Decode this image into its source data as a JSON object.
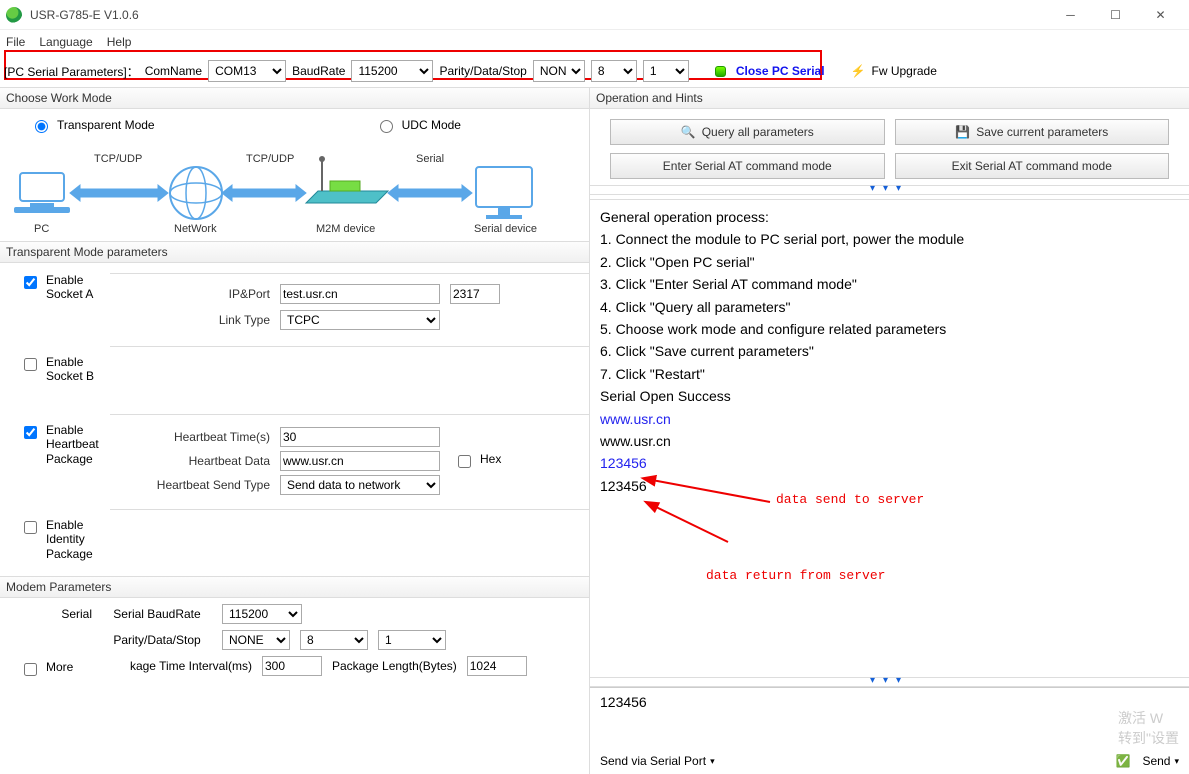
{
  "titlebar": {
    "title": "USR-G785-E V1.0.6"
  },
  "menu": {
    "file": "File",
    "language": "Language",
    "help": "Help"
  },
  "toolbar": {
    "pcparams_label": "[PC Serial Parameters]：",
    "comname_label": "ComName",
    "comname": "COM13",
    "baud_label": "BaudRate",
    "baud": "115200",
    "pds_label": "Parity/Data/Stop",
    "parity": "NONE",
    "databits": "8",
    "stopbits": "1",
    "close_serial": "Close PC Serial",
    "fw": "Fw Upgrade"
  },
  "workmode": {
    "header": "Choose Work Mode",
    "transparent": "Transparent Mode",
    "udc": "UDC Mode",
    "diagram": {
      "pc": "PC",
      "network": "NetWork",
      "m2m": "M2M device",
      "serial_dev": "Serial device",
      "tcpudp": "TCP/UDP",
      "serial": "Serial"
    }
  },
  "tparams": {
    "header": "Transparent Mode parameters",
    "enable_a": "Enable Socket A",
    "ipport_label": "IP&Port",
    "ip": "test.usr.cn",
    "port": "2317",
    "linktype_label": "Link Type",
    "linktype": "TCPC",
    "enable_b": "Enable Socket B",
    "enable_hb": "Enable Heartbeat Package",
    "hb_time_label": "Heartbeat Time(s)",
    "hb_time": "30",
    "hb_data_label": "Heartbeat Data",
    "hb_data": "www.usr.cn",
    "hex": "Hex",
    "hb_sendtype_label": "Heartbeat Send Type",
    "hb_sendtype": "Send data to network",
    "enable_id": "Enable Identity Package"
  },
  "modem": {
    "header": "Modem Parameters",
    "serial": "Serial",
    "sb_label": "Serial BaudRate",
    "sb": "115200",
    "pds_label": "Parity/Data/Stop",
    "p": "NONE",
    "d": "8",
    "s": "1",
    "pti_label": "kage Time Interval(ms)",
    "pti": "300",
    "pl_label": "Package Length(Bytes)",
    "pl": "1024",
    "more": "More"
  },
  "ops": {
    "header": "Operation and Hints",
    "query": "Query all parameters",
    "save": "Save current parameters",
    "enter_at": "Enter Serial AT command mode",
    "exit_at": "Exit Serial AT command mode"
  },
  "log": {
    "title": "General operation process:",
    "s1": "1. Connect the module to PC serial port, power the module",
    "s2": "2. Click \"Open PC serial\"",
    "s3": "3. Click \"Enter Serial AT command mode\"",
    "s4": "4. Click \"Query all parameters\"",
    "s5": "5. Choose work mode and configure related parameters",
    "s6": "6. Click \"Save current parameters\"",
    "s7": "7. Click \"Restart\"",
    "open_ok": "Serial Open Success",
    "link": "www.usr.cn",
    "echo1": "www.usr.cn",
    "send1": "123456",
    "recv1": "123456",
    "ann_send": "data send to server",
    "ann_recv": "data return from server"
  },
  "inputbar": {
    "value": "123456",
    "send_via": "Send via Serial Port",
    "send": "Send"
  },
  "watermark": {
    "l1": "激活 W",
    "l2": "转到\"设置"
  }
}
